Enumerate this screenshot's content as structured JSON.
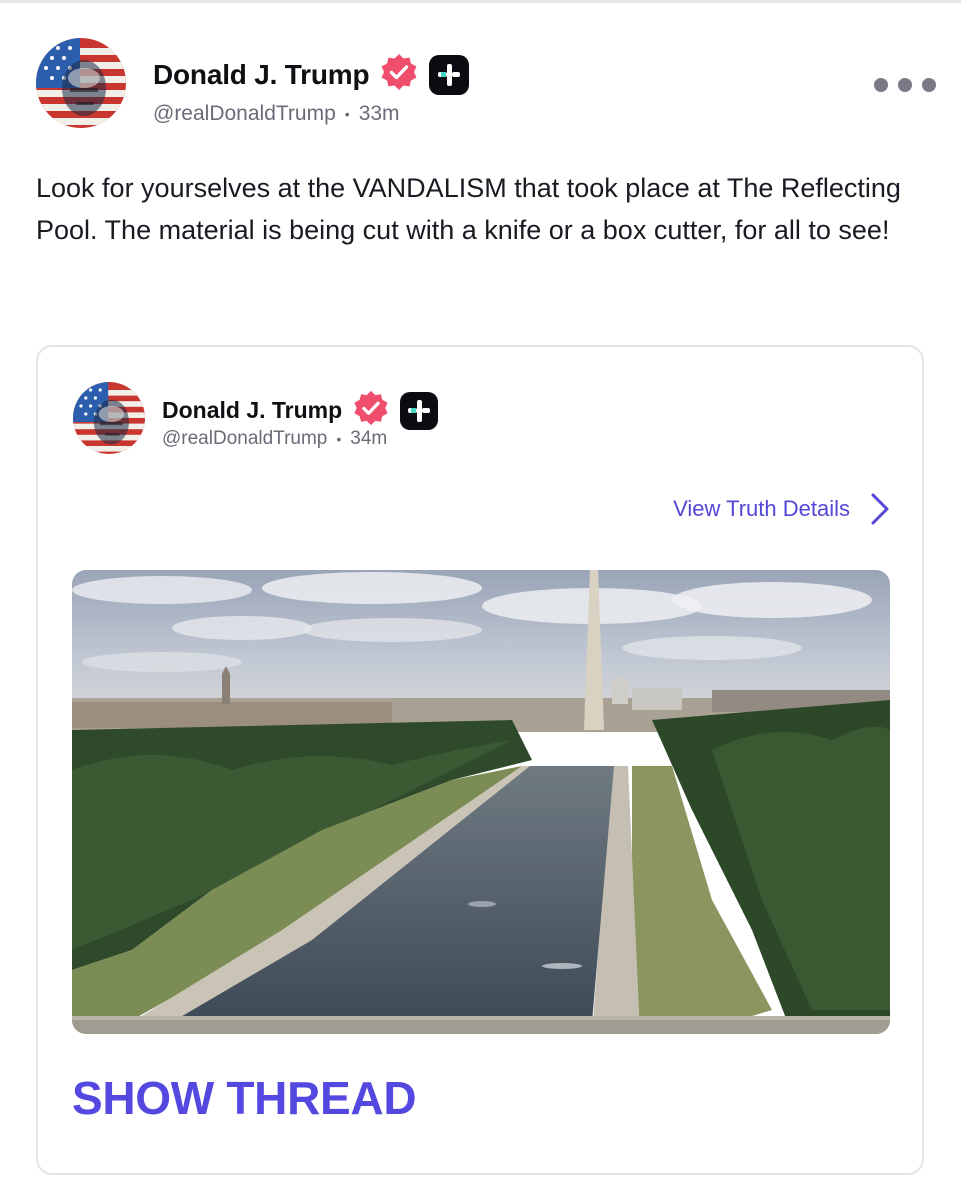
{
  "post": {
    "author": {
      "display_name": "Donald J. Trump",
      "handle": "@realDonaldTrump",
      "avatar_icon": "flag-portrait-avatar",
      "verified_icon": "verified-badge-icon",
      "plus_icon": "truth-plus-icon"
    },
    "separator": "•",
    "timestamp": "33m",
    "more_icon": "more-options-icon",
    "text": "Look for yourselves at the VANDALISM that took place at The Reflecting Pool. The material is being cut with a knife or a box cutter, for all to see!"
  },
  "quoted": {
    "author": {
      "display_name": "Donald J. Trump",
      "handle": "@realDonaldTrump"
    },
    "separator": "•",
    "timestamp": "34m",
    "view_details_label": "View Truth Details",
    "view_details_icon": "chevron-right-icon",
    "media": {
      "type": "image"
    },
    "show_thread_label": "SHOW THREAD"
  },
  "colors": {
    "accent": "#5448e0",
    "link": "#5447d6",
    "verified": "#ef4f6c",
    "plus_badge": "#0b0b12",
    "plus_accent": "#3fd9c4",
    "secondary_text": "#6b6b78",
    "border": "#e3e3e8"
  }
}
